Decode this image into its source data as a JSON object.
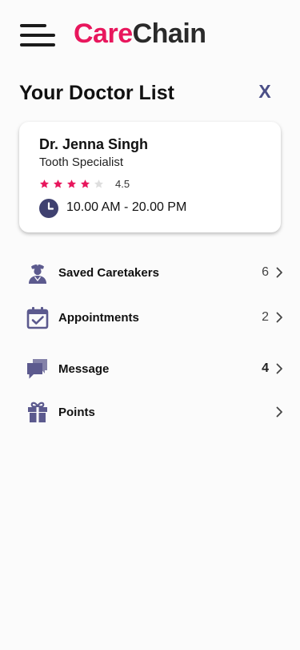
{
  "header": {
    "logo_care": "Care",
    "logo_chain": "Chain"
  },
  "page": {
    "title": "Your Doctor List",
    "close_label": "X"
  },
  "doctor": {
    "name": "Dr. Jenna Singh",
    "specialty": "Tooth Specialist",
    "rating": "4.5",
    "rating_value": 4.5,
    "rating_max": 5,
    "hours": "10.00 AM - 20.00 PM"
  },
  "menu": [
    {
      "label": "Saved Caretakers",
      "count": "6",
      "icon": "nurse-icon"
    },
    {
      "label": "Appointments",
      "count": "2",
      "icon": "calendar-check-icon"
    },
    {
      "label": "Message",
      "count": "4",
      "icon": "chat-icon"
    },
    {
      "label": "Points",
      "count": "",
      "icon": "gift-icon"
    }
  ],
  "colors": {
    "brand_pink": "#e8175d",
    "accent_indigo": "#4b4f87",
    "icon_purple": "#5c5a8e"
  }
}
